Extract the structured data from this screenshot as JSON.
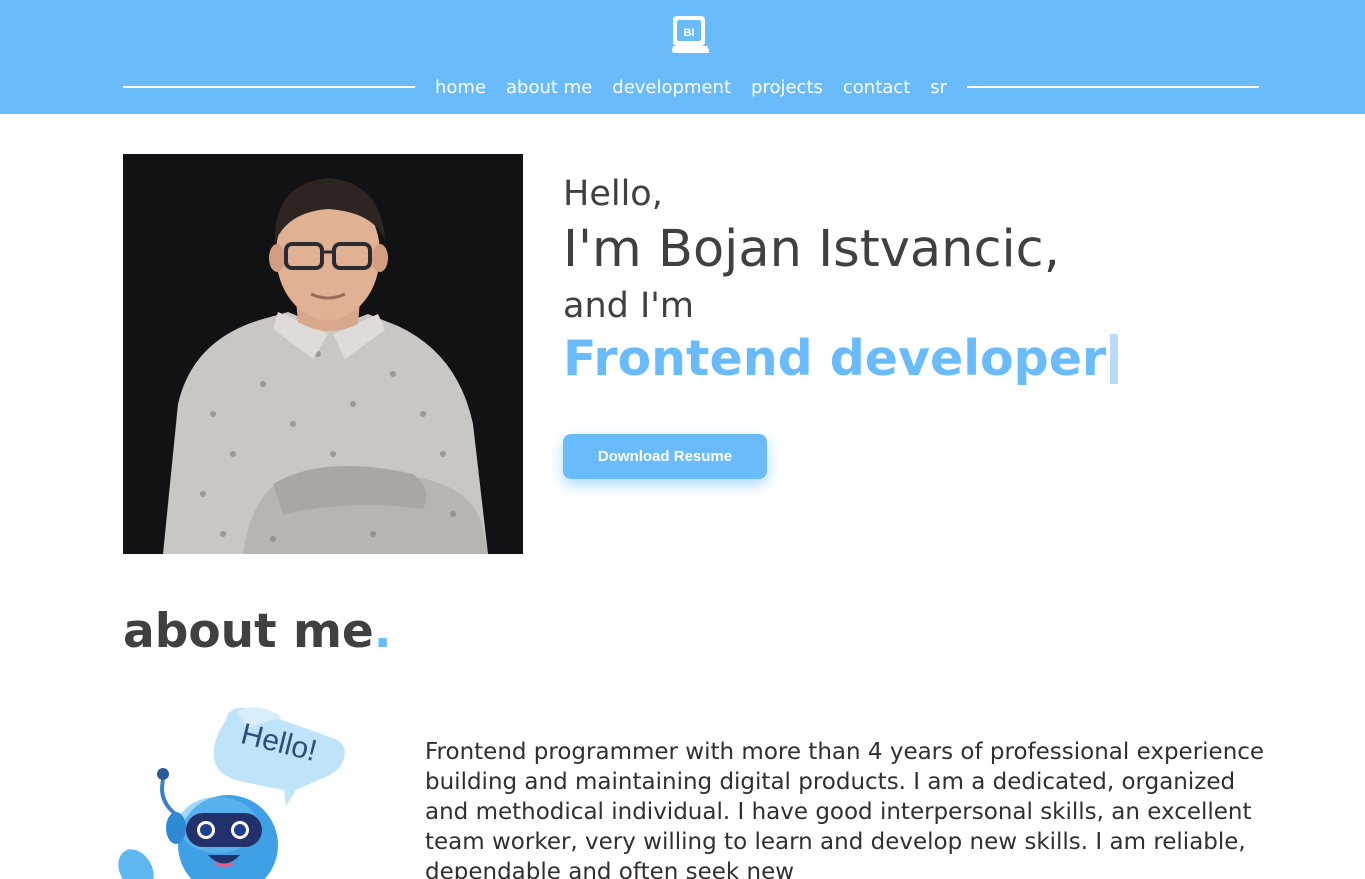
{
  "header": {
    "logo_text": "BI",
    "nav": [
      "home",
      "about me",
      "development",
      "projects",
      "contact",
      "sr"
    ]
  },
  "hero": {
    "greeting": "Hello,",
    "name": "I'm Bojan Istvancic,",
    "and_im": "and I'm",
    "role": "Frontend developer",
    "download_button": "Download Resume"
  },
  "about": {
    "title": "about me",
    "title_dot": ".",
    "bubble": "Hello!",
    "text": "Frontend programmer with more than 4 years of professional experience building and maintaining digital products. I am a dedicated, organized and methodical individual. I have good interpersonal skills, an excellent team worker, very willing to learn and develop new skills. I am reliable, dependable and often seek new"
  },
  "colors": {
    "accent": "#69bbfc",
    "text": "#404040",
    "background": "#ffffff"
  }
}
